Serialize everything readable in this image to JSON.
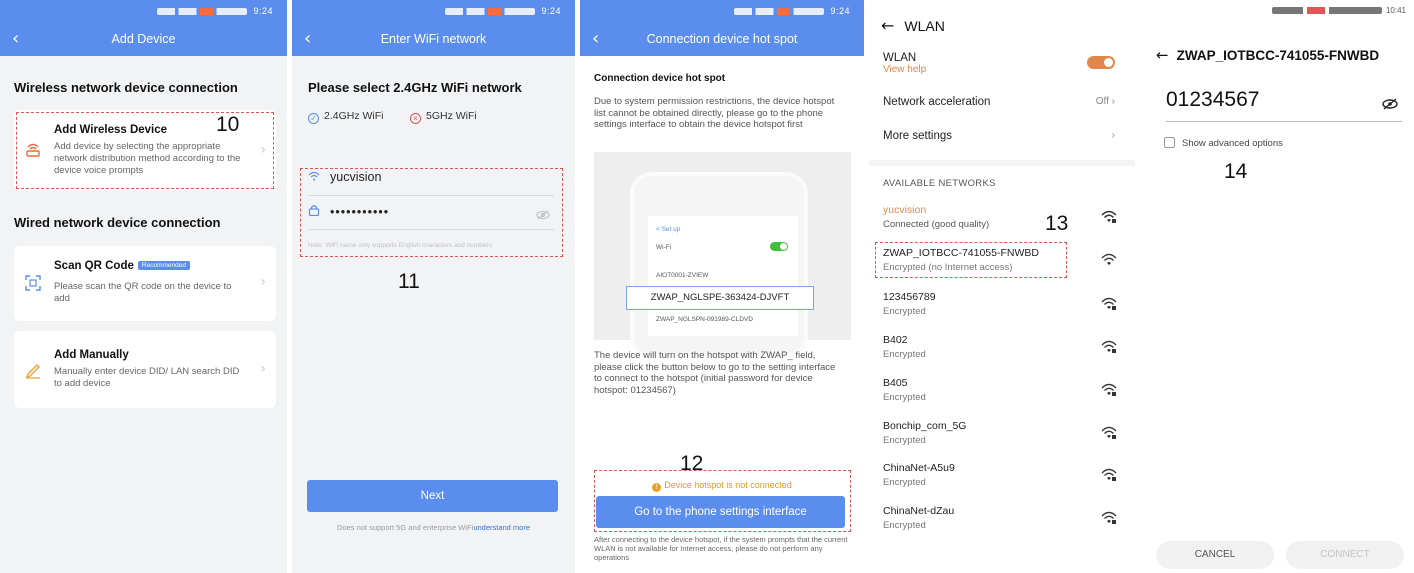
{
  "status_time": "9:24",
  "screen1": {
    "title": "Add Device",
    "wireless_section": "Wireless network device connection",
    "wired_section": "Wired network device connection",
    "cards": [
      {
        "title": "Add Wireless Device",
        "desc": "Add device by selecting the appropriate network distribution method according to the device voice prompts",
        "badge": ""
      },
      {
        "title": "Scan QR Code",
        "desc": "Please scan the QR code on the device to add",
        "badge": "Recommended"
      },
      {
        "title": "Add Manually",
        "desc": "Manually enter device DID/ LAN search DID to add device",
        "badge": ""
      }
    ],
    "annotation": "10"
  },
  "screen2": {
    "title": "Enter WiFi network",
    "heading": "Please select 2.4GHz WiFi network",
    "option_ok": "2.4GHz WiFi",
    "option_bad": "5GHz WiFi",
    "ssid": "yucvision",
    "password_mask": "•••••••••••",
    "note": "Note: WiFi name only supports English characters and numbers",
    "annotation": "11",
    "next_label": "Next",
    "footer_text": "Does not support 5G and enterprise WiFi",
    "footer_link": "understand more"
  },
  "screen3": {
    "title": "Connection device hot spot",
    "heading": "Connection device hot spot",
    "intro": "Due to system permission restrictions, the device hotspot list cannot be obtained directly, please go to the phone settings interface to obtain the device hotspot first",
    "illus": {
      "setup": "< Set up",
      "wifi": "Wi-Fi",
      "net1": "AIOT0001-ZVIEW",
      "net_highlight": "ZWAP_NGLSPE-363424-DJVFT",
      "net2": "ZWAP_NGLSPN-091989-CLDVD"
    },
    "instructions": "The device will turn on the hotspot with ZWAP_ field, please click the button below to go to the setting interface to connect to the hotspot (initial password for device hotspot: 01234567)",
    "annotation": "12",
    "warning": "Device hotspot is not connected",
    "button_label": "Go to the phone settings interface",
    "footer": "After connecting to the device hotspot, if the system prompts that the current WLAN is not available for Internet access, please do not perform any operations"
  },
  "screen4": {
    "title": "WLAN",
    "wlan_label": "WLAN",
    "view_help": "View help",
    "accel_label": "Network acceleration",
    "accel_value": "Off",
    "more_label": "More settings",
    "available_caption": "AVAILABLE NETWORKS",
    "annotation": "13",
    "networks": [
      {
        "name": "yucvision",
        "status": "Connected (good quality)"
      },
      {
        "name": "ZWAP_IOTBCC-741055-FNWBD",
        "status": "Encrypted (no Internet access)"
      },
      {
        "name": "123456789",
        "status": "Encrypted"
      },
      {
        "name": "B402",
        "status": "Encrypted"
      },
      {
        "name": "B405",
        "status": "Encrypted"
      },
      {
        "name": "Bonchip_com_5G",
        "status": "Encrypted"
      },
      {
        "name": "ChinaNet-A5u9",
        "status": "Encrypted"
      },
      {
        "name": "ChinaNet-dZau",
        "status": "Encrypted"
      }
    ]
  },
  "screen5": {
    "status_time": "10:41",
    "title": "ZWAP_IOTBCC-741055-FNWBD",
    "password": "01234567",
    "advanced": "Show advanced options",
    "annotation": "14",
    "cancel": "CANCEL",
    "connect": "CONNECT"
  },
  "colors": {
    "accent": "#5b8def",
    "annotation_border": "#e05555",
    "warning": "#e09a1a",
    "toggle": "#e2874c"
  }
}
